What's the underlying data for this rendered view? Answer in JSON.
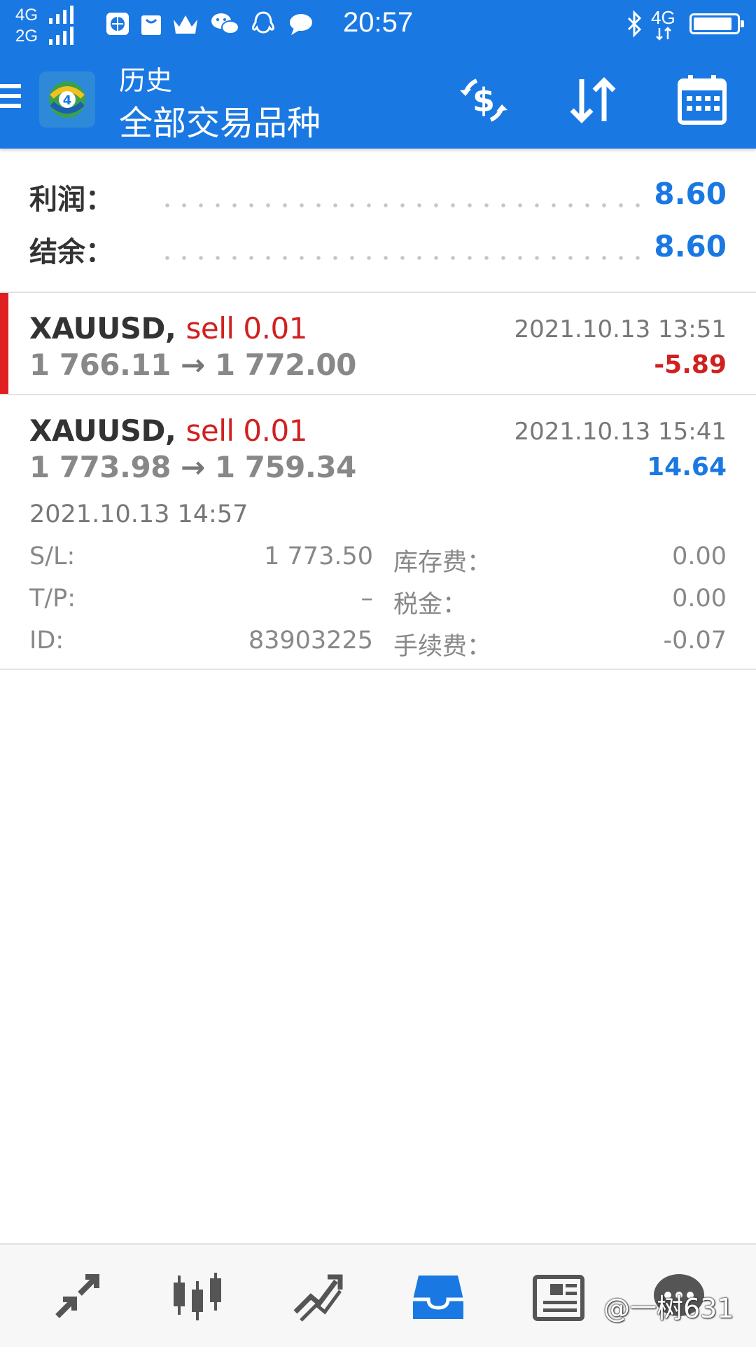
{
  "status_bar": {
    "network_1": "4G",
    "network_2": "2G",
    "time": "20:57",
    "right_network": "4G",
    "battery_level": 0.9
  },
  "app_bar": {
    "title_small": "历史",
    "title_big": "全部交易品种",
    "icons": [
      "menu-icon",
      "app-logo-icon",
      "currency-exchange-icon",
      "sort-icon",
      "calendar-icon"
    ]
  },
  "summary": {
    "profit_label": "利润：",
    "profit_value": "8.60",
    "balance_label": "结余：",
    "balance_value": "8.60"
  },
  "deals": [
    {
      "symbol": "XAUUSD,",
      "type": "sell 0.01",
      "open_price": "1 766.11",
      "close_price": "1 772.00",
      "datetime": "2021.10.13 13:51",
      "profit": "-5.89"
    },
    {
      "symbol": "XAUUSD,",
      "type": "sell 0.01",
      "open_price": "1 773.98",
      "close_price": "1 759.34",
      "datetime": "2021.10.13 15:41",
      "profit": "14.64",
      "open_time": "2021.10.13 14:57",
      "sl_label": "S/L:",
      "sl_value": "1 773.50",
      "swap_label": "库存费：",
      "swap_value": "0.00",
      "tp_label": "T/P:",
      "tp_value": "–",
      "tax_label": "税金：",
      "tax_value": "0.00",
      "id_label": "ID:",
      "id_value": "83903225",
      "fee_label": "手续费：",
      "fee_value": "-0.07"
    }
  ],
  "bottom_nav": {
    "items": [
      "quotes-icon",
      "chart-candles-icon",
      "trend-icon",
      "history-inbox-icon",
      "news-icon",
      "chat-icon"
    ],
    "active": "history-inbox-icon"
  },
  "watermark": "@一树631",
  "colors": {
    "primary": "#1a78e2",
    "negative": "#d02020",
    "nav_icon": "#555555"
  }
}
